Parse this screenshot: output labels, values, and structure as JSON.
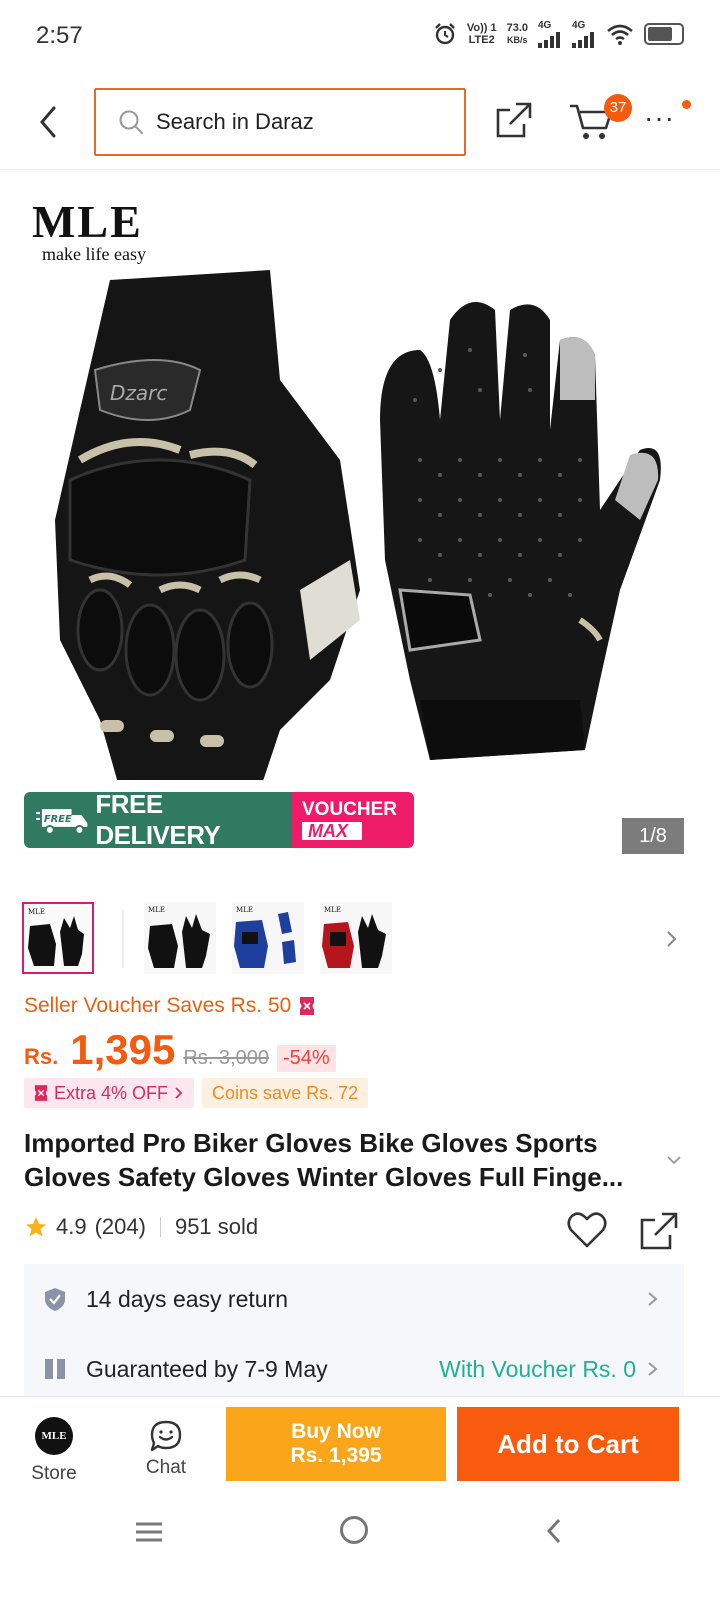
{
  "status_bar": {
    "time": "2:57",
    "network_speed": "73.0",
    "network_unit": "KB/s",
    "volte": "Vo)) 1",
    "lte": "LTE2",
    "signal1": "4G",
    "signal2": "4G"
  },
  "header": {
    "search_placeholder": "Search in Daraz",
    "cart_count": "37"
  },
  "gallery": {
    "brand_name": "MLE",
    "brand_tagline": "make life easy",
    "free_delivery": "FREE DELIVERY",
    "free_label": "FREE",
    "voucher_top": "VOUCHER",
    "voucher_max": "MAX",
    "page_counter": "1/8",
    "thumbnails": [
      {
        "label": "MLE",
        "variant": "black"
      },
      {
        "label": "MLE",
        "variant": "black"
      },
      {
        "label": "MLE",
        "variant": "blue"
      },
      {
        "label": "MLE",
        "variant": "red"
      }
    ]
  },
  "price": {
    "seller_voucher": "Seller Voucher Saves Rs. 50",
    "currency": "Rs.",
    "current": "1,395",
    "original": "Rs. 3,000",
    "discount": "-54%",
    "extra_off": "Extra 4% OFF",
    "coins": "Coins save Rs. 72"
  },
  "product": {
    "title": "Imported Pro Biker Gloves Bike Gloves Sports Gloves Safety Gloves Winter Gloves Full Finge...",
    "rating": "4.9",
    "reviews": "(204)",
    "sold": "951 sold"
  },
  "services": {
    "return": "14 days easy return",
    "delivery": "Guaranteed by 7-9 May",
    "delivery_voucher": "With Voucher Rs. 0"
  },
  "action_bar": {
    "store_label": "Store",
    "store_logo": "MLE",
    "chat_label": "Chat",
    "buy_now_line1": "Buy Now",
    "buy_now_line2": "Rs. 1,395",
    "add_to_cart": "Add to Cart"
  },
  "colors": {
    "brand_orange": "#f55a0f",
    "search_border": "#e8692a",
    "buy_now": "#fba61a",
    "add_to_cart": "#f85b0d",
    "free_delivery_green": "#2f7a61",
    "voucher_pink": "#ee1c68",
    "teal": "#1fb193"
  }
}
